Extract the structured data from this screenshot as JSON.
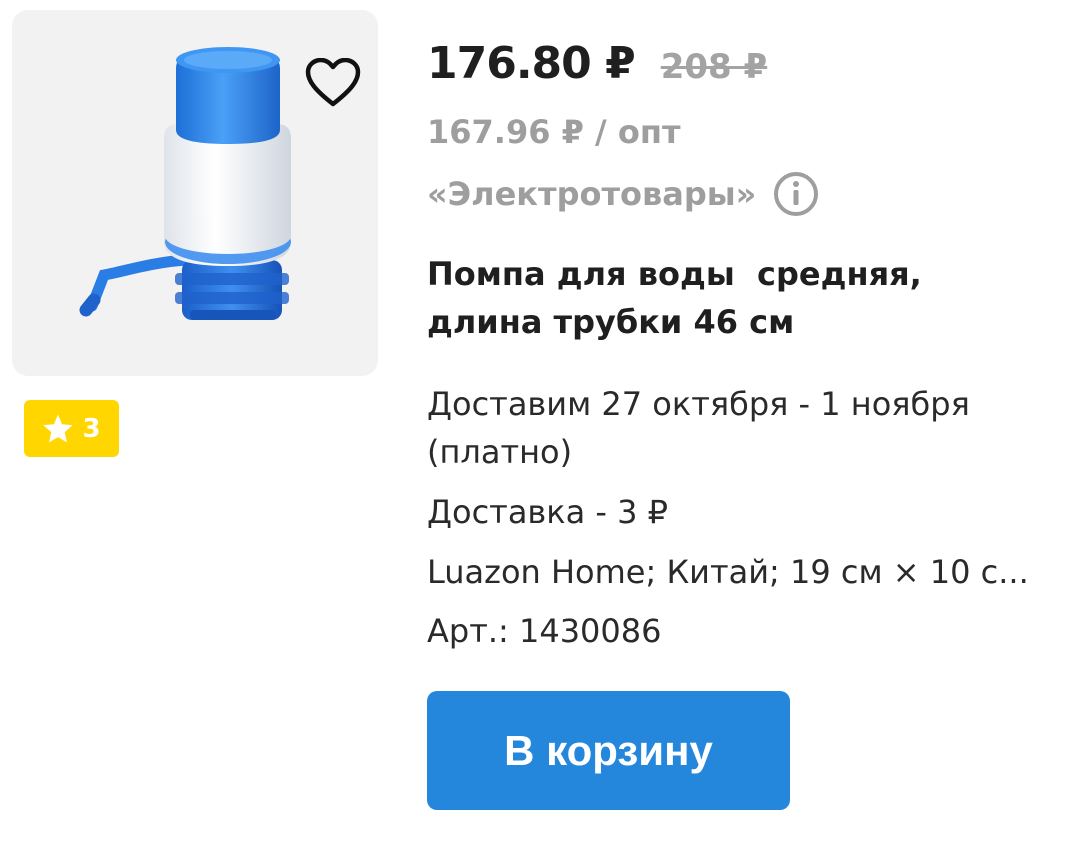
{
  "product": {
    "price_current": "176.80 ₽",
    "price_old": "208 ₽",
    "price_wholesale": "167.96 ₽ / опт",
    "brand": "«Электротовары»",
    "title": "Помпа для воды  средняя, длина трубки 46 см",
    "delivery_dates": "Доставим 27 октября - 1 ноября (платно)",
    "delivery_cost": "Доставка - 3 ₽",
    "specs": "Luazon Home; Китай; 19 см × 10 с...",
    "sku": "Арт.: 1430086",
    "rating_badge": "3",
    "image_alt": "water-pump-product-image"
  },
  "actions": {
    "cart_label": "В корзину"
  },
  "icons": {
    "favorite": "heart-icon",
    "info": "info-icon",
    "rating": "star-icon"
  },
  "colors": {
    "accent": "#2487dc",
    "badge": "#ffd600",
    "muted_text": "#9e9e9e",
    "old_price": "#a3a3a3"
  }
}
